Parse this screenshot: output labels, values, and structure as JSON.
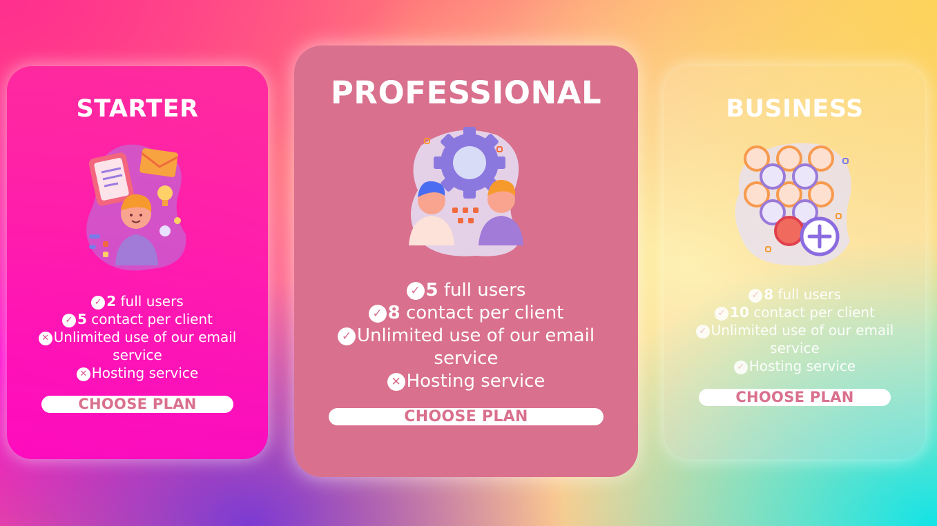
{
  "colors": {
    "starter_card": "#ff1fae",
    "professional_card": "#d9708d",
    "button_text": "#d9708d",
    "button_bg": "#ffffff"
  },
  "plans": [
    {
      "title": "STARTER",
      "illustration": "person-with-documents-illustration",
      "features": [
        {
          "icon": "check-icon",
          "num": "2",
          "text": " full users"
        },
        {
          "icon": "check-icon",
          "num": "5",
          "text": " contact per client"
        },
        {
          "icon": "cross-icon",
          "num": "",
          "text": "Unlimited use of our email service"
        },
        {
          "icon": "cross-icon",
          "num": "",
          "text": "Hosting service"
        }
      ],
      "button": "CHOOSE PLAN"
    },
    {
      "title": "PROFESSIONAL",
      "illustration": "team-with-gear-illustration",
      "features": [
        {
          "icon": "check-icon",
          "num": "5",
          "text": " full users"
        },
        {
          "icon": "check-icon",
          "num": "8",
          "text": " contact per client"
        },
        {
          "icon": "check-icon",
          "num": "",
          "text": "Unlimited use of our email service"
        },
        {
          "icon": "cross-icon",
          "num": "",
          "text": "Hosting service"
        }
      ],
      "button": "CHOOSE PLAN"
    },
    {
      "title": "BUSINESS",
      "illustration": "user-network-add-illustration",
      "features": [
        {
          "icon": "check-icon",
          "num": "8",
          "text": " full users"
        },
        {
          "icon": "check-icon",
          "num": "10",
          "text": " contact per client"
        },
        {
          "icon": "check-icon",
          "num": "",
          "text": "Unlimited use of our email service"
        },
        {
          "icon": "check-icon",
          "num": "",
          "text": "Hosting service"
        }
      ],
      "button": "CHOOSE PLAN"
    }
  ]
}
